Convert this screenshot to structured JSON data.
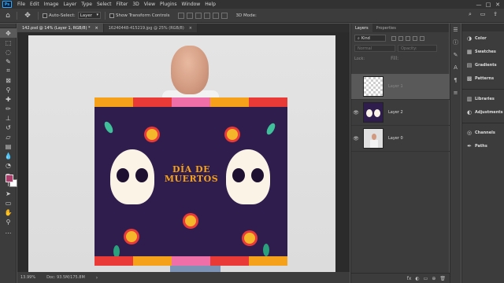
{
  "app": {
    "logo": "Ps"
  },
  "menu": [
    "File",
    "Edit",
    "Image",
    "Layer",
    "Type",
    "Select",
    "Filter",
    "3D",
    "View",
    "Plugins",
    "Window",
    "Help"
  ],
  "window_controls": [
    "—",
    "□",
    "✕"
  ],
  "options_bar": {
    "auto_select_label": "Auto-Select:",
    "auto_select_value": "Layer",
    "transform_label": "Show Transform Controls",
    "mode_3d": "3D Mode:"
  },
  "doc_tabs": [
    {
      "label": "142.psd @ 14% (Layer 1, RGB/8) *",
      "close": "×",
      "active": true
    },
    {
      "label": "16240448-415219.jpg @ 25% (RGB/8)",
      "close": "×",
      "active": false
    }
  ],
  "poster": {
    "title_line1": "DÍA DE",
    "title_line2": "MUERTOS"
  },
  "status": {
    "zoom": "13.99%",
    "doc": "Doc: 93.5M/175.8M",
    "arrow": "›"
  },
  "layers_panel": {
    "tabs": [
      "Layers",
      "Properties"
    ],
    "kind_label": "Kind",
    "blend_mode": "Normal",
    "opacity_label": "Opacity:",
    "lock_label": "Lock:",
    "fill_label": "Fill:",
    "layers": [
      {
        "name": "Layer 1",
        "thumb": "checker",
        "visible": false,
        "selected": true
      },
      {
        "name": "Layer 2",
        "thumb": "dark",
        "visible": true,
        "selected": false
      },
      {
        "name": "Layer 0",
        "thumb": "photo",
        "visible": true,
        "selected": false
      }
    ],
    "bottom_icons": [
      "fx",
      "◐",
      "▭",
      "⊕",
      "🗑"
    ]
  },
  "right_panel": {
    "items": [
      {
        "label": "Color",
        "icon": "palette-icon"
      },
      {
        "label": "Swatches",
        "icon": "grid-icon"
      },
      {
        "label": "Gradients",
        "icon": "gradient-icon"
      },
      {
        "label": "Patterns",
        "icon": "pattern-icon"
      },
      {
        "label": "Libraries",
        "icon": "library-icon"
      },
      {
        "label": "Adjustments",
        "icon": "adjust-icon"
      },
      {
        "label": "Channels",
        "icon": "channels-icon"
      },
      {
        "label": "Paths",
        "icon": "pen-icon"
      }
    ]
  },
  "colors": {
    "foreground": "#ad3e6b",
    "background": "#ffffff",
    "poster_bg": "#2f1d4d"
  }
}
